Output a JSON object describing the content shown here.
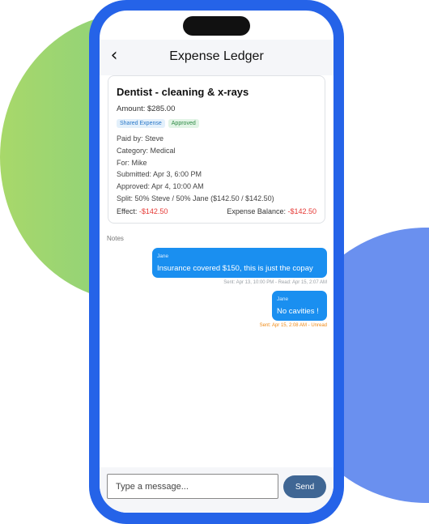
{
  "header": {
    "title": "Expense Ledger",
    "back_icon": "‹"
  },
  "expense": {
    "title": "Dentist - cleaning & x-rays",
    "amount": "Amount: $285.00",
    "badges": [
      "Shared Expense",
      "Approved"
    ],
    "paid_by": "Paid by: Steve",
    "category": "Category: Medical",
    "for": "For: Mike",
    "submitted": "Submitted: Apr 3, 6:00 PM",
    "approved": "Approved: Apr 4, 10:00 AM",
    "split": "Split: 50% Steve / 50% Jane ($142.50 / $142.50)",
    "effect_label": "Effect: ",
    "effect_value": "-$142.50",
    "balance_label": "Expense Balance: ",
    "balance_value": "-$142.50"
  },
  "notes": {
    "label": "Notes",
    "messages": [
      {
        "sender": "Jane",
        "text": "Insurance covered $150, this is just the copay",
        "meta": "Sent: Apr 13, 10:00 PM - Read: Apr 15, 2:07 AM"
      },
      {
        "sender": "Jane",
        "text": "No cavities !",
        "meta": "Sent: Apr 15, 2:08 AM - Unread"
      }
    ]
  },
  "composer": {
    "placeholder": "Type a message...",
    "value": "",
    "send_label": "Send"
  },
  "colors": {
    "accent": "#2563e8",
    "bubble": "#1a8ff0",
    "negative": "#e53935",
    "unread": "#ef8a16",
    "send_button": "#3f6694"
  }
}
